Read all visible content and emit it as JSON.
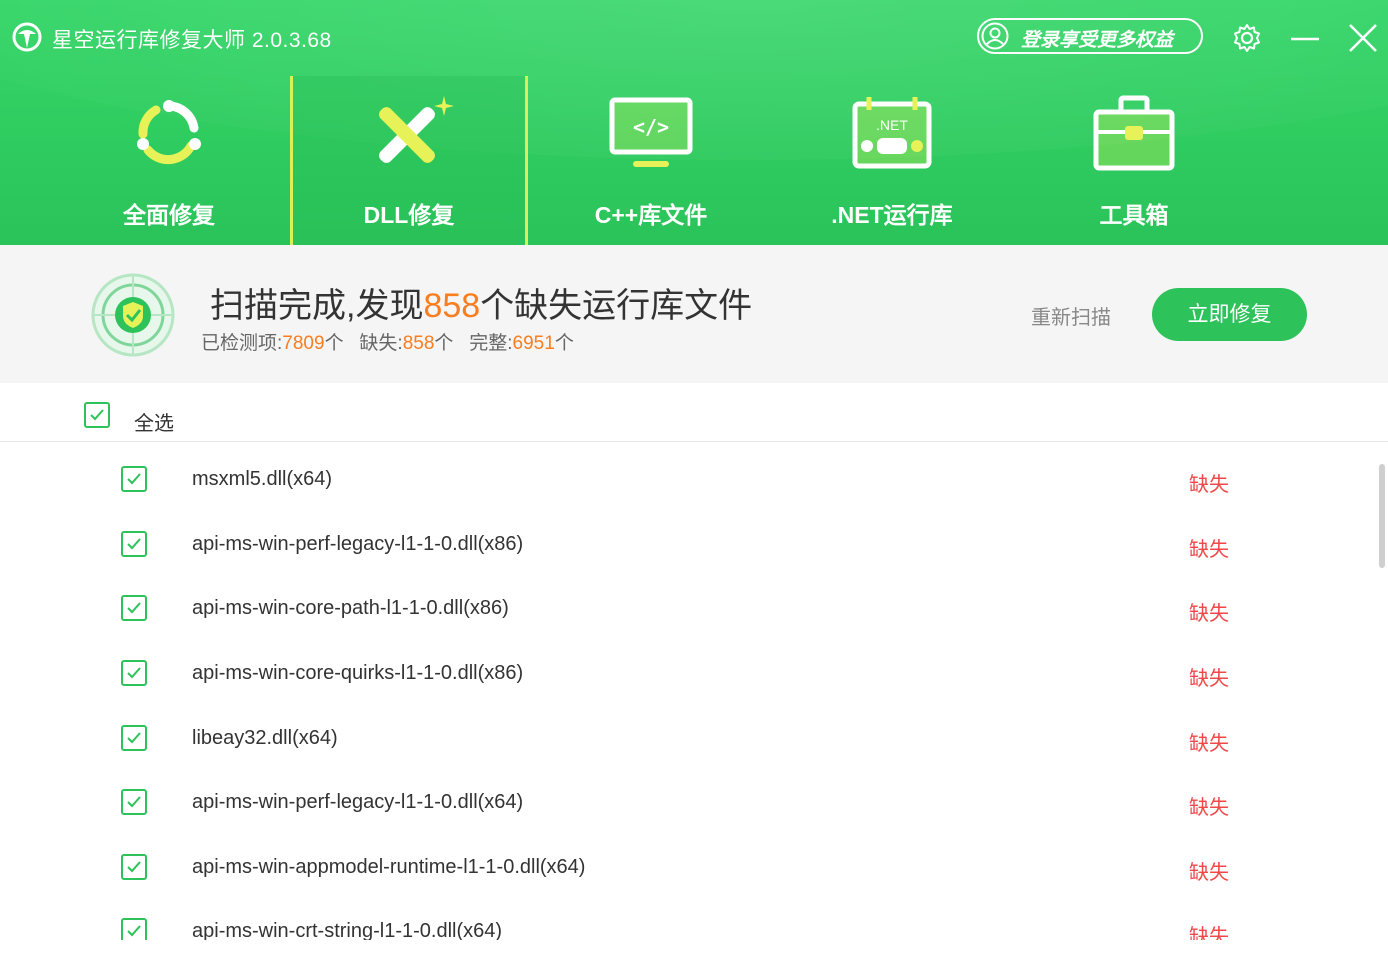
{
  "app": {
    "title": "星空运行库修复大师 2.0.3.68",
    "login_label": "登录享受更多权益"
  },
  "tabs": [
    {
      "label": "全面修复",
      "icon": "refresh-cycle-icon"
    },
    {
      "label": "DLL修复",
      "icon": "dll-repair-icon",
      "active": true
    },
    {
      "label": "C++库文件",
      "icon": "code-monitor-icon"
    },
    {
      "label": ".NET运行库",
      "icon": "dotnet-calendar-icon"
    },
    {
      "label": "工具箱",
      "icon": "toolbox-icon"
    }
  ],
  "summary": {
    "headline_prefix": "扫描完成,发现",
    "headline_count": "858",
    "headline_suffix": "个缺失运行库文件",
    "checked_label": "已检测项:",
    "checked_value": "7809",
    "missing_label": "缺失:",
    "missing_value": "858",
    "complete_label": "完整:",
    "complete_value": "6951",
    "unit": "个",
    "rescan_label": "重新扫描",
    "fix_label": "立即修复"
  },
  "select_all": {
    "label": "全选",
    "checked": true
  },
  "files": [
    {
      "name": "msxml5.dll(x64)",
      "status": "缺失"
    },
    {
      "name": "api-ms-win-perf-legacy-l1-1-0.dll(x86)",
      "status": "缺失"
    },
    {
      "name": "api-ms-win-core-path-l1-1-0.dll(x86)",
      "status": "缺失"
    },
    {
      "name": "api-ms-win-core-quirks-l1-1-0.dll(x86)",
      "status": "缺失"
    },
    {
      "name": "libeay32.dll(x64)",
      "status": "缺失"
    },
    {
      "name": "api-ms-win-perf-legacy-l1-1-0.dll(x64)",
      "status": "缺失"
    },
    {
      "name": "api-ms-win-appmodel-runtime-l1-1-0.dll(x64)",
      "status": "缺失"
    },
    {
      "name": "api-ms-win-crt-string-l1-1-0.dll(x64)",
      "status": "缺失"
    }
  ],
  "colors": {
    "accent": "#2ec25a",
    "highlight": "#fa7d1e",
    "missing": "#f04848"
  }
}
